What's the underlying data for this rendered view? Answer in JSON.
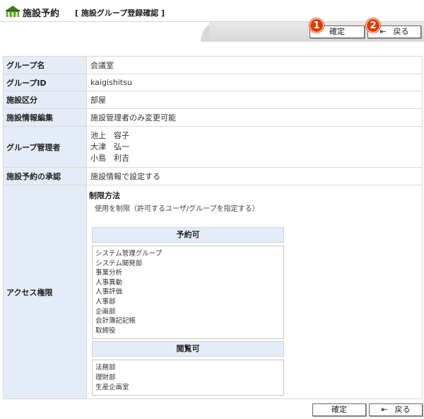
{
  "header": {
    "app_title": "施設予約",
    "sub_title": "[ 施設グループ登録確認 ]"
  },
  "toolbar": {
    "confirm_label": "確定",
    "back_label": "戻る",
    "badge_1": "1",
    "badge_2": "2"
  },
  "rows": {
    "group_name_label": "グループ名",
    "group_name_value": "会議室",
    "group_id_label": "グループID",
    "group_id_value": "kaigishitsu",
    "category_label": "施設区分",
    "category_value": "部屋",
    "edit_label": "施設情報編集",
    "edit_value": "施設管理者のみ変更可能",
    "managers_label": "グループ管理者",
    "managers": [
      "池上　容子",
      "大津　弘一",
      "小島　利吉"
    ],
    "approval_label": "施設予約の承認",
    "approval_value": "施設情報で設定する",
    "access_label": "アクセス権限",
    "restrict_title": "制限方法",
    "restrict_desc": "使用を制限（許可するユーザ/グループを指定する）",
    "reserve_head": "予約可",
    "reserve_items": [
      "システム管理グループ",
      "システム開発部",
      "事業分析",
      "人事異動",
      "人事評価",
      "人事部",
      "企画部",
      "会計簿記記帳",
      "取締役"
    ],
    "view_head": "閲覧可",
    "view_items": [
      "法務部",
      "理財部",
      "生産企画室"
    ]
  },
  "colors": {
    "badge": "#e03a00",
    "label_bg": "#e4ecf7",
    "toolbar_bg": "#d8d8d8"
  },
  "icons": {
    "app": "facility-icon",
    "back": "back-arrow-icon"
  }
}
